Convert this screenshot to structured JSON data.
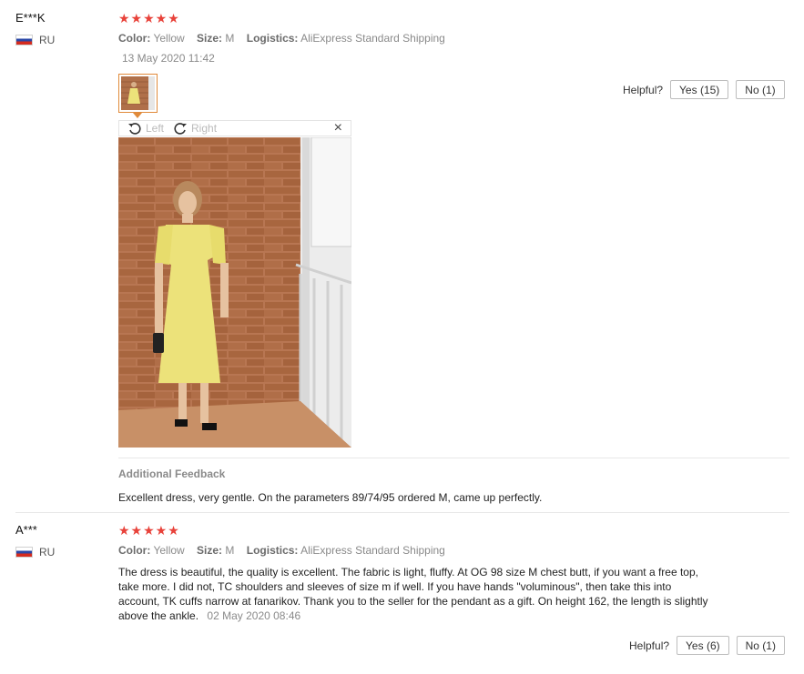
{
  "reviews": [
    {
      "user": "E***K",
      "country": "RU",
      "stars": "★★★★★",
      "color_label": "Color:",
      "color_value": "Yellow",
      "size_label": "Size:",
      "size_value": "M",
      "logistics_label": "Logistics:",
      "logistics_value": "AliExpress Standard Shipping",
      "date": "13 May 2020 11:42",
      "rotate_left": "Left",
      "rotate_right": "Right",
      "close": "×",
      "helpful_label": "Helpful?",
      "yes": "Yes (15)",
      "no": "No (1)",
      "additional_title": "Additional Feedback",
      "additional_text": "Excellent dress, very gentle. On the parameters 89/74/95 ordered M, came up perfectly."
    },
    {
      "user": "A***",
      "country": "RU",
      "stars": "★★★★★",
      "color_label": "Color:",
      "color_value": "Yellow",
      "size_label": "Size:",
      "size_value": "M",
      "logistics_label": "Logistics:",
      "logistics_value": "AliExpress Standard Shipping",
      "text": "The dress is beautiful, the quality is excellent. The fabric is light, fluffy. At OG 98 size M chest butt, if you want a free top, take more. I did not, TC shoulders and sleeves of size m if well. If you have hands \"voluminous\", then take this into account, TK cuffs narrow at fanarikov. Thank you to the seller for the pendant as a gift. On height 162, the length is slightly above the ankle.",
      "date": "02 May 2020 08:46",
      "helpful_label": "Helpful?",
      "yes": "Yes (6)",
      "no": "No (1)"
    }
  ],
  "colors": {
    "stars": "#e8423a",
    "thumb_border": "#e08a3a"
  },
  "icons": [
    "flag-ru-icon",
    "star-icon",
    "rotate-left-icon",
    "rotate-right-icon",
    "close-icon"
  ]
}
